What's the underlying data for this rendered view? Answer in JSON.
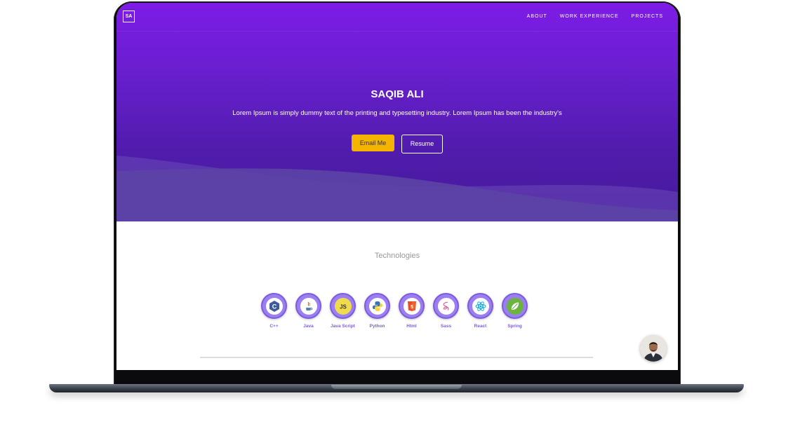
{
  "brand": {
    "logo_text": "SA"
  },
  "nav": {
    "items": [
      {
        "label": "ABOUT"
      },
      {
        "label": "WORK EXPERIENCE"
      },
      {
        "label": "PROJECTS"
      }
    ]
  },
  "hero": {
    "name": "SAQIB ALI",
    "description": "Lorem Ipsum is simply dummy text of the printing and typesetting industry. Lorem Ipsum has been the industry's",
    "email_button": "Email Me",
    "resume_button": "Resume"
  },
  "technologies": {
    "title": "Technologies",
    "items": [
      {
        "label": "C++",
        "icon": "cpp-icon"
      },
      {
        "label": "Java",
        "icon": "java-icon"
      },
      {
        "label": "Java Script",
        "icon": "javascript-icon"
      },
      {
        "label": "Python",
        "icon": "python-icon"
      },
      {
        "label": "Html",
        "icon": "html5-icon"
      },
      {
        "label": "Sass",
        "icon": "sass-icon"
      },
      {
        "label": "React",
        "icon": "react-icon"
      },
      {
        "label": "Spring",
        "icon": "spring-icon"
      }
    ]
  },
  "colors": {
    "hero_top": "#7d1ce6",
    "hero_bottom": "#45199a",
    "accent_button": "#f4b400",
    "tech_circle": "#9b7ef0",
    "tech_label": "#7b5fd6"
  }
}
